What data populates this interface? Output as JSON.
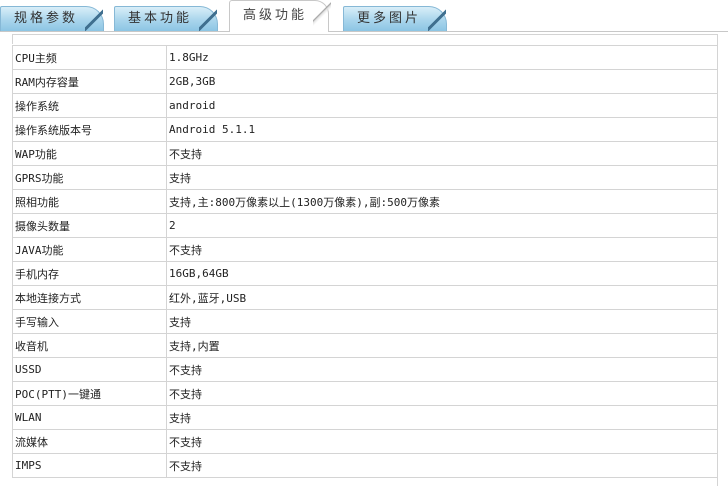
{
  "tabs": [
    {
      "label": "规格参数",
      "active": false
    },
    {
      "label": "基本功能",
      "active": false
    },
    {
      "label": "高级功能",
      "active": true
    },
    {
      "label": "更多图片",
      "active": false
    }
  ],
  "specs": [
    {
      "key": "CPU主频",
      "value": "1.8GHz"
    },
    {
      "key": "RAM内存容量",
      "value": "2GB,3GB"
    },
    {
      "key": "操作系统",
      "value": "android"
    },
    {
      "key": "操作系统版本号",
      "value": "Android 5.1.1"
    },
    {
      "key": "WAP功能",
      "value": "不支持"
    },
    {
      "key": "GPRS功能",
      "value": "支持"
    },
    {
      "key": "照相功能",
      "value": "支持,主:800万像素以上(1300万像素),副:500万像素"
    },
    {
      "key": "摄像头数量",
      "value": "2"
    },
    {
      "key": "JAVA功能",
      "value": "不支持"
    },
    {
      "key": "手机内存",
      "value": "16GB,64GB"
    },
    {
      "key": "本地连接方式",
      "value": "红外,蓝牙,USB"
    },
    {
      "key": "手写输入",
      "value": "支持"
    },
    {
      "key": "收音机",
      "value": "支持,内置"
    },
    {
      "key": "USSD",
      "value": "不支持"
    },
    {
      "key": "POC(PTT)一键通",
      "value": "不支持"
    },
    {
      "key": "WLAN",
      "value": "支持"
    },
    {
      "key": "流媒体",
      "value": "不支持"
    },
    {
      "key": "IMPS",
      "value": "不支持"
    }
  ]
}
